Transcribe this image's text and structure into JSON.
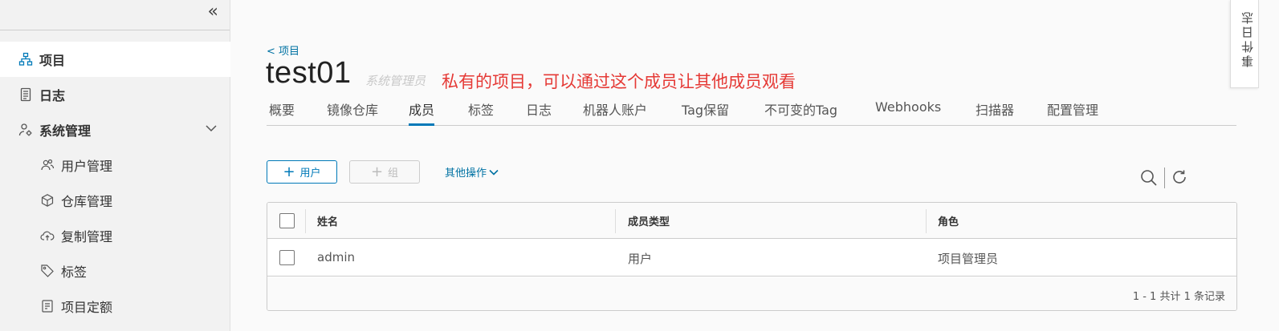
{
  "sidebar": {
    "items": [
      {
        "label": "项目",
        "icon": "project-icon"
      },
      {
        "label": "日志",
        "icon": "log-icon"
      },
      {
        "label": "系统管理",
        "icon": "admin-icon"
      },
      {
        "label": "用户管理",
        "icon": "users-icon"
      },
      {
        "label": "仓库管理",
        "icon": "cube-icon"
      },
      {
        "label": "复制管理",
        "icon": "cloud-icon"
      },
      {
        "label": "标签",
        "icon": "tag-icon"
      },
      {
        "label": "项目定额",
        "icon": "quota-icon"
      }
    ]
  },
  "breadcrumb": "< 项目",
  "project": {
    "name": "test01",
    "role": "系统管理员"
  },
  "annotation": "私有的项目，可以通过这个成员让其他成员观看",
  "tabs": [
    "概要",
    "镜像仓库",
    "成员",
    "标签",
    "日志",
    "机器人账户",
    "Tag保留",
    "不可变的Tag",
    "Webhooks",
    "扫描器",
    "配置管理"
  ],
  "toolbar": {
    "add_user": "用户",
    "add_group": "组",
    "more_ops": "其他操作"
  },
  "table": {
    "headers": [
      "姓名",
      "成员类型",
      "角色"
    ],
    "rows": [
      [
        "admin",
        "用户",
        "项目管理员"
      ]
    ],
    "footer": "1 - 1 共计 1 条记录"
  },
  "event_log": "事件日志",
  "colors": {
    "accent": "#0079b8",
    "annotation": "#e53935"
  }
}
